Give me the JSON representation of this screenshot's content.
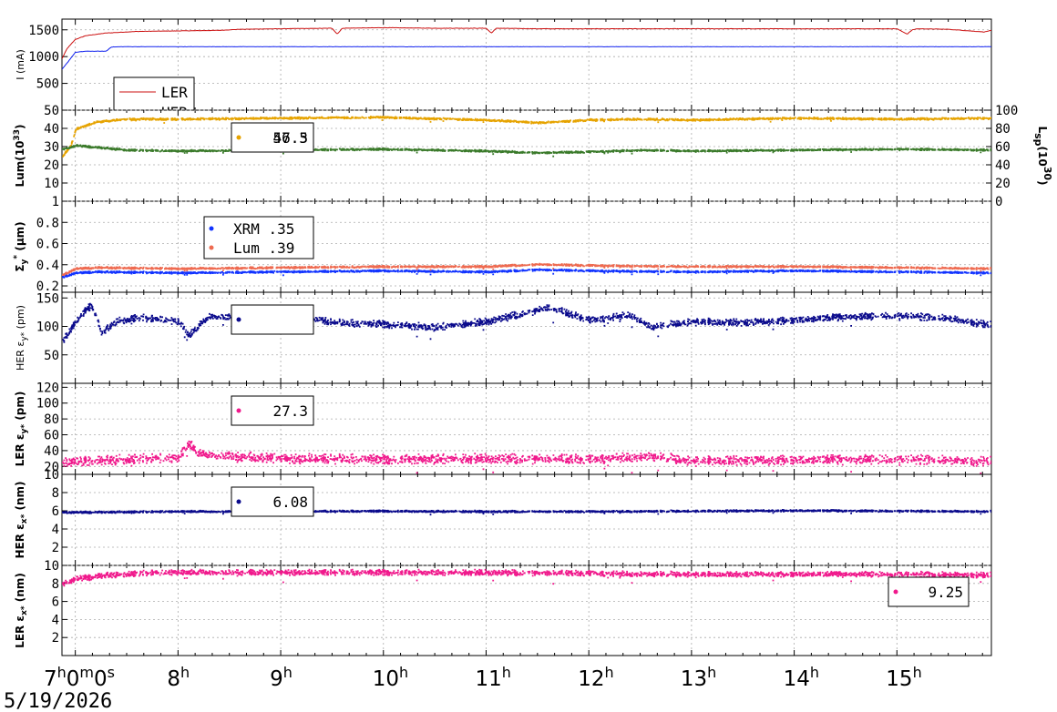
{
  "date": "5/19/2026",
  "x_axis": {
    "ticks": [
      {
        "value": 7,
        "base": "7",
        "sup": "h",
        "tail_base": "0",
        "tail_sup": "m",
        "tail2_base": "0",
        "tail2_sup": "s"
      },
      {
        "value": 8,
        "base": "8",
        "sup": "h"
      },
      {
        "value": 9,
        "base": "9",
        "sup": "h"
      },
      {
        "value": 10,
        "base": "10",
        "sup": "h"
      },
      {
        "value": 11,
        "base": "11",
        "sup": "h"
      },
      {
        "value": 12,
        "base": "12",
        "sup": "h"
      },
      {
        "value": 13,
        "base": "13",
        "sup": "h"
      },
      {
        "value": 14,
        "base": "14",
        "sup": "h"
      },
      {
        "value": 15,
        "base": "15",
        "sup": "h"
      }
    ],
    "range_hours": [
      6.87,
      15.92
    ]
  },
  "colors": {
    "ler": "#cc1111",
    "her": "#1122ee",
    "lum_orange": "#e6a300",
    "lum_green": "#3a7a2a",
    "xrm_blue": "#1133ff",
    "lum_salmon": "#ee6a50",
    "navy": "#0a0a8c",
    "magenta": "#f0198c"
  },
  "chart_data": [
    {
      "type": "line",
      "id": "current",
      "ylabel": "I (mA)",
      "ylim": [
        0,
        1700
      ],
      "yticks": [
        500,
        1000,
        1500
      ],
      "grid": true,
      "legend": {
        "placement": "bottom-left",
        "entries": [
          "LER",
          "HER"
        ]
      },
      "series": [
        {
          "name": "LER",
          "color_key": "ler",
          "x": [
            6.87,
            6.92,
            7.0,
            7.1,
            7.3,
            7.6,
            8.0,
            8.4,
            8.6,
            9.0,
            9.5,
            9.55,
            9.6,
            10.0,
            10.5,
            11.0,
            11.05,
            11.1,
            11.5,
            12.0,
            12.5,
            13.0,
            13.5,
            14.0,
            14.5,
            15.0,
            15.1,
            15.15,
            15.2,
            15.5,
            15.85,
            15.92
          ],
          "y": [
            960,
            1150,
            1320,
            1390,
            1440,
            1470,
            1480,
            1490,
            1510,
            1520,
            1530,
            1420,
            1530,
            1540,
            1530,
            1530,
            1440,
            1530,
            1520,
            1520,
            1520,
            1520,
            1520,
            1520,
            1520,
            1520,
            1420,
            1500,
            1520,
            1510,
            1460,
            1490
          ]
        },
        {
          "name": "HER",
          "color_key": "her",
          "x": [
            6.87,
            6.92,
            7.0,
            7.1,
            7.3,
            7.35,
            7.5,
            8.0,
            9.0,
            10.0,
            11.0,
            12.0,
            13.0,
            14.0,
            15.0,
            15.92
          ],
          "y": [
            760,
            880,
            1080,
            1100,
            1100,
            1180,
            1185,
            1185,
            1185,
            1185,
            1185,
            1185,
            1185,
            1185,
            1185,
            1185
          ]
        }
      ]
    },
    {
      "type": "scatter",
      "id": "luminosity",
      "ylabel_base": "Lum(10",
      "ylabel_sup": "33",
      "ylabel_tail": ")",
      "ylim": [
        0,
        50
      ],
      "yticks": [
        10,
        20,
        30,
        40,
        50
      ],
      "right_ylabel_base": "L",
      "right_ylabel_sub": "sp",
      "right_ylabel_mid": "(10",
      "right_ylabel_sup": "30",
      "right_ylabel_tail": ")",
      "right_ylim": [
        0,
        100
      ],
      "right_yticks": [
        0,
        20,
        40,
        60,
        80,
        100
      ],
      "legend": {
        "placement": "top-left",
        "entries": [
          "47.3",
          "56.5"
        ]
      },
      "series": [
        {
          "color_key": "lum_orange",
          "axis": "left",
          "x": [
            6.87,
            6.95,
            7.0,
            7.2,
            7.5,
            8.0,
            9.0,
            10.0,
            11.0,
            11.5,
            12.0,
            12.5,
            13.0,
            14.0,
            15.0,
            15.92
          ],
          "y": [
            25,
            31,
            40,
            44,
            45.5,
            45.5,
            46,
            46.5,
            45,
            43.5,
            45,
            45.5,
            45,
            46,
            45.5,
            46
          ]
        },
        {
          "color_key": "lum_green",
          "axis": "left",
          "x": [
            6.87,
            6.95,
            7.0,
            7.2,
            7.5,
            8.0,
            9.0,
            10.0,
            11.0,
            11.5,
            12.0,
            12.5,
            13.0,
            14.0,
            15.0,
            15.92
          ],
          "y": [
            29,
            30,
            31,
            30,
            28.5,
            28,
            28.5,
            29,
            28,
            27,
            27.5,
            28.5,
            28,
            28.5,
            29,
            28.5
          ]
        }
      ]
    },
    {
      "type": "scatter",
      "id": "sigma_y",
      "ylabel_base": "Σ",
      "ylabel_sub": "y",
      "ylabel_sup": "*",
      "ylabel_tail": " (μm)",
      "ylim": [
        0.14,
        1
      ],
      "yticks": [
        0.2,
        0.4,
        0.6,
        0.8,
        1
      ],
      "legend": {
        "placement": "top-left",
        "entries": [
          "XRM  .35",
          "Lum  .39"
        ]
      },
      "series": [
        {
          "name": "XRM",
          "color_key": "xrm_blue",
          "x": [
            6.87,
            7.0,
            7.2,
            8.0,
            9.0,
            10.0,
            11.0,
            11.5,
            12.0,
            13.0,
            14.0,
            15.0,
            15.92
          ],
          "y": [
            0.29,
            0.33,
            0.34,
            0.33,
            0.34,
            0.35,
            0.34,
            0.36,
            0.35,
            0.34,
            0.35,
            0.34,
            0.33
          ]
        },
        {
          "name": "Lum",
          "color_key": "lum_salmon",
          "x": [
            6.87,
            7.0,
            7.2,
            8.0,
            9.0,
            10.0,
            11.0,
            11.5,
            12.0,
            13.0,
            14.0,
            15.0,
            15.92
          ],
          "y": [
            0.31,
            0.37,
            0.38,
            0.37,
            0.38,
            0.39,
            0.39,
            0.41,
            0.4,
            0.39,
            0.39,
            0.38,
            0.37
          ]
        }
      ]
    },
    {
      "type": "scatter",
      "id": "her_eps_y",
      "ylabel_base": "HER ε",
      "ylabel_sub": "y*",
      "ylabel_tail": " (pm)",
      "ylim": [
        0,
        160
      ],
      "yticks": [
        50,
        100,
        150
      ],
      "legend": {
        "placement": "top-left",
        "entries": [
          ""
        ]
      },
      "series": [
        {
          "color_key": "navy",
          "x": [
            6.87,
            7.0,
            7.15,
            7.25,
            7.4,
            7.6,
            8.0,
            8.1,
            8.3,
            9.0,
            9.2,
            9.5,
            10.0,
            10.5,
            11.0,
            11.2,
            11.5,
            11.6,
            12.0,
            12.4,
            12.6,
            13.0,
            13.5,
            14.0,
            14.5,
            15.0,
            15.5,
            15.92
          ],
          "y": [
            75,
            110,
            140,
            90,
            110,
            117,
            110,
            85,
            120,
            110,
            120,
            108,
            105,
            100,
            110,
            118,
            130,
            135,
            112,
            122,
            100,
            110,
            108,
            112,
            118,
            120,
            115,
            103
          ]
        }
      ]
    },
    {
      "type": "scatter",
      "id": "ler_eps_y",
      "ylabel_base": "LER ε",
      "ylabel_sub": "y*",
      "ylabel_tail": " (pm)",
      "ylim": [
        10,
        125
      ],
      "yticks": [
        10,
        20,
        40,
        60,
        80,
        100,
        120
      ],
      "legend": {
        "placement": "top-left",
        "entries": [
          "27.3"
        ]
      },
      "series": [
        {
          "color_key": "magenta",
          "x": [
            6.87,
            7.5,
            8.0,
            8.1,
            8.2,
            9.0,
            10.0,
            11.0,
            12.0,
            12.6,
            13.0,
            14.0,
            15.0,
            15.92
          ],
          "y": [
            26,
            30,
            32,
            50,
            36,
            31,
            30,
            31,
            30,
            34,
            28,
            29,
            30,
            27
          ]
        }
      ]
    },
    {
      "type": "scatter",
      "id": "her_eps_x",
      "ylabel_base": "HER ε",
      "ylabel_sub": "x*",
      "ylabel_tail": " (nm)",
      "ylim": [
        0,
        10
      ],
      "yticks": [
        2,
        4,
        6,
        8
      ],
      "legend": {
        "placement": "top-left",
        "entries": [
          "6.08"
        ]
      },
      "series": [
        {
          "color_key": "navy",
          "x": [
            6.87,
            8.0,
            9.0,
            10.0,
            11.0,
            12.0,
            13.0,
            14.0,
            15.0,
            15.92
          ],
          "y": [
            5.9,
            6.0,
            6.0,
            6.05,
            6.0,
            6.0,
            6.05,
            6.1,
            6.05,
            6.0
          ]
        }
      ]
    },
    {
      "type": "scatter",
      "id": "ler_eps_x",
      "ylabel_base": "LER ε",
      "ylabel_sub": "x*",
      "ylabel_tail": " (nm)",
      "ylim": [
        0,
        10
      ],
      "yticks": [
        2,
        4,
        6,
        8,
        10
      ],
      "legend": {
        "placement": "bottom-right",
        "entries": [
          "9.25"
        ]
      },
      "series": [
        {
          "color_key": "magenta",
          "x": [
            6.87,
            7.0,
            7.3,
            7.8,
            9.0,
            10.0,
            11.0,
            12.0,
            13.0,
            14.0,
            15.0,
            15.92
          ],
          "y": [
            8.0,
            8.6,
            9.0,
            9.3,
            9.3,
            9.3,
            9.3,
            9.2,
            9.1,
            9.1,
            9.1,
            9.0
          ]
        }
      ]
    }
  ]
}
